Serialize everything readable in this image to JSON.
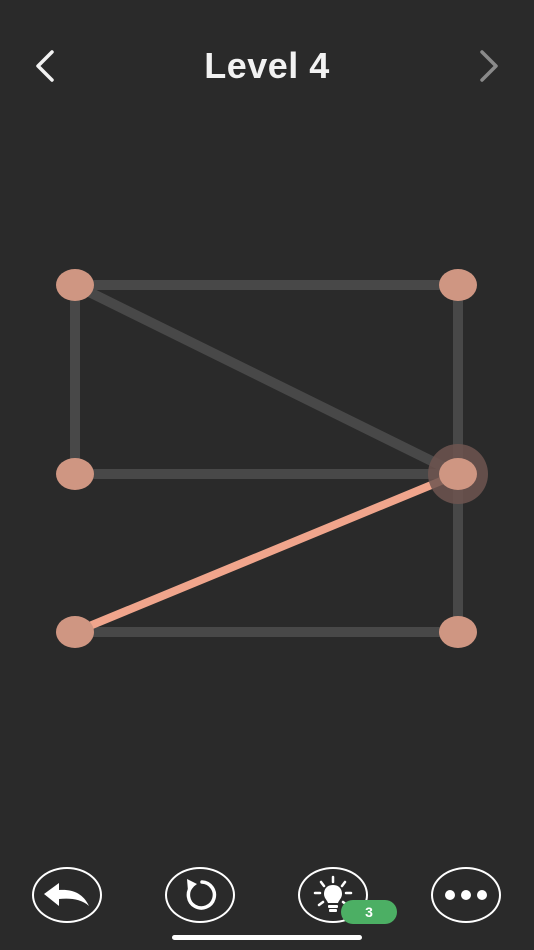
{
  "header": {
    "title": "Level 4",
    "back_icon": "chevron-left-icon",
    "next_icon": "chevron-right-icon"
  },
  "colors": {
    "background": "#2a2a2a",
    "edge_unvisited": "#484848",
    "edge_visited": "#f0a58c",
    "node": "#cf9682",
    "node_active_halo": "#6e5550",
    "text": "#f2f2f2",
    "badge": "#4caf64",
    "next_disabled": "#8a8a8a"
  },
  "puzzle": {
    "nodes": [
      {
        "id": "A",
        "col": 0,
        "row": 0
      },
      {
        "id": "B",
        "col": 1,
        "row": 0
      },
      {
        "id": "C",
        "col": 0,
        "row": 1
      },
      {
        "id": "D",
        "col": 1,
        "row": 1,
        "active": true
      },
      {
        "id": "E",
        "col": 0,
        "row": 2
      },
      {
        "id": "F",
        "col": 1,
        "row": 2
      }
    ],
    "edges": [
      {
        "from": "A",
        "to": "B",
        "visited": false
      },
      {
        "from": "A",
        "to": "C",
        "visited": false
      },
      {
        "from": "B",
        "to": "D",
        "visited": false
      },
      {
        "from": "A",
        "to": "D",
        "visited": false
      },
      {
        "from": "C",
        "to": "D",
        "visited": false
      },
      {
        "from": "D",
        "to": "F",
        "visited": false
      },
      {
        "from": "E",
        "to": "F",
        "visited": false
      },
      {
        "from": "E",
        "to": "D",
        "visited": true
      }
    ]
  },
  "toolbar": {
    "undo_icon": "undo-arrow-icon",
    "restart_icon": "restart-icon",
    "hint_icon": "lightbulb-icon",
    "hint_count": "3",
    "more_icon": "more-dots-icon"
  }
}
